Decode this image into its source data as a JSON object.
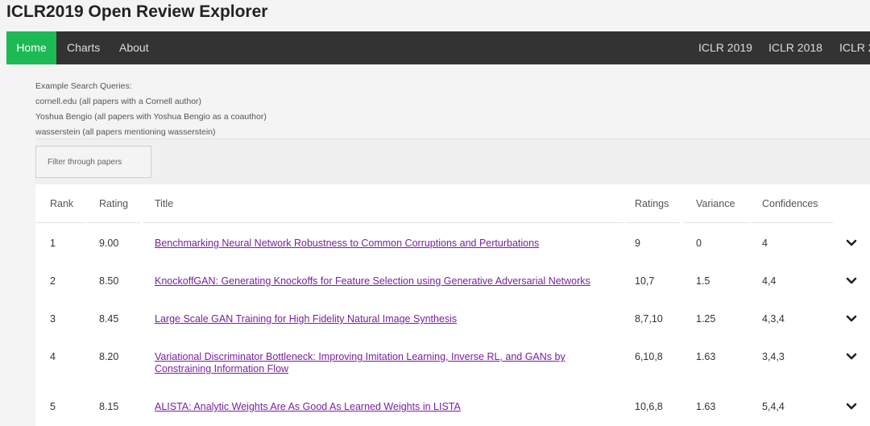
{
  "site": {
    "title": "ICLR2019 Open Review Explorer"
  },
  "nav": {
    "left": [
      "Home",
      "Charts",
      "About"
    ],
    "right": [
      "ICLR 2019",
      "ICLR 2018",
      "ICLR 2"
    ]
  },
  "hints": {
    "heading": "Example Search Queries:",
    "lines": [
      "cornell.edu (all papers with a Cornell author)",
      "Yoshua Bengio (all papers with Yoshua Bengio as a coauthor)",
      "wasserstein (all papers mentioning wasserstein)"
    ]
  },
  "filter": {
    "placeholder": "Filter through papers"
  },
  "table": {
    "headers": [
      "Rank",
      "Rating",
      "Title",
      "Ratings",
      "Variance",
      "Confidences"
    ],
    "rows": [
      {
        "rank": "1",
        "rating": "9.00",
        "title": "Benchmarking Neural Network Robustness to Common Corruptions and Perturbations",
        "ratings": "9",
        "variance": "0",
        "confidences": "4"
      },
      {
        "rank": "2",
        "rating": "8.50",
        "title": "KnockoffGAN: Generating Knockoffs for Feature Selection using Generative Adversarial Networks",
        "ratings": "10,7",
        "variance": "1.5",
        "confidences": "4,4"
      },
      {
        "rank": "3",
        "rating": "8.45",
        "title": "Large Scale GAN Training for High Fidelity Natural Image Synthesis",
        "ratings": "8,7,10",
        "variance": "1.25",
        "confidences": "4,3,4"
      },
      {
        "rank": "4",
        "rating": "8.20",
        "title": "Variational Discriminator Bottleneck: Improving Imitation Learning, Inverse RL, and GANs by Constraining Information Flow",
        "ratings": "6,10,8",
        "variance": "1.63",
        "confidences": "3,4,3"
      },
      {
        "rank": "5",
        "rating": "8.15",
        "title": "ALISTA: Analytic Weights Are As Good As Learned Weights in LISTA",
        "ratings": "10,6,8",
        "variance": "1.63",
        "confidences": "5,4,4"
      }
    ]
  },
  "icons": {
    "expand": "chevron-down-icon"
  },
  "colors": {
    "nav_bg": "#333333",
    "home_active": "#1db954",
    "link": "#7b1fa2"
  }
}
